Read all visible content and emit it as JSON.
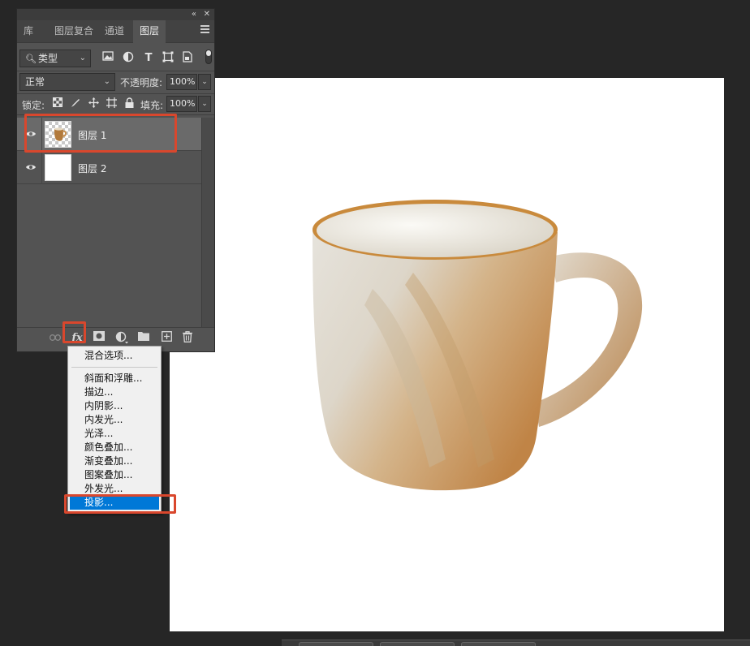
{
  "panel": {
    "window_controls": {
      "collapse": "«",
      "close": "✕"
    },
    "tabs": [
      {
        "label": "库",
        "active": false
      },
      {
        "label": "图层复合",
        "active": false
      },
      {
        "label": "通道",
        "active": false
      },
      {
        "label": "图层",
        "active": true
      }
    ],
    "filter": {
      "label": "类型",
      "icons": [
        "image-filter-icon",
        "adjustment-filter-icon",
        "type-filter-icon",
        "shape-filter-icon",
        "smart-object-filter-icon"
      ]
    },
    "blend_mode": "正常",
    "opacity_label": "不透明度:",
    "opacity_value": "100%",
    "lock_label": "锁定:",
    "fill_label": "填充:",
    "fill_value": "100%",
    "layers": [
      {
        "name": "图层 1",
        "visible": true,
        "selected": true,
        "thumbnail": "mug-transparent"
      },
      {
        "name": "图层 2",
        "visible": true,
        "selected": false,
        "thumbnail": "white-fill"
      }
    ],
    "bottom_icons": [
      "link-icon",
      "fx-icon",
      "mask-icon",
      "adjustment-icon",
      "folder-icon",
      "new-layer-icon",
      "trash-icon"
    ],
    "fx_label": "fx"
  },
  "fx_menu": {
    "top_item": "混合选项...",
    "items": [
      "斜面和浮雕...",
      "描边...",
      "内阴影...",
      "内发光...",
      "光泽...",
      "颜色叠加...",
      "渐变叠加...",
      "图案叠加...",
      "外发光...",
      "投影..."
    ],
    "selected": "投影..."
  },
  "colors": {
    "highlight": "#d9472d",
    "menu_selection": "#0078d7",
    "panel_bg": "#535353",
    "app_bg": "#262626"
  }
}
